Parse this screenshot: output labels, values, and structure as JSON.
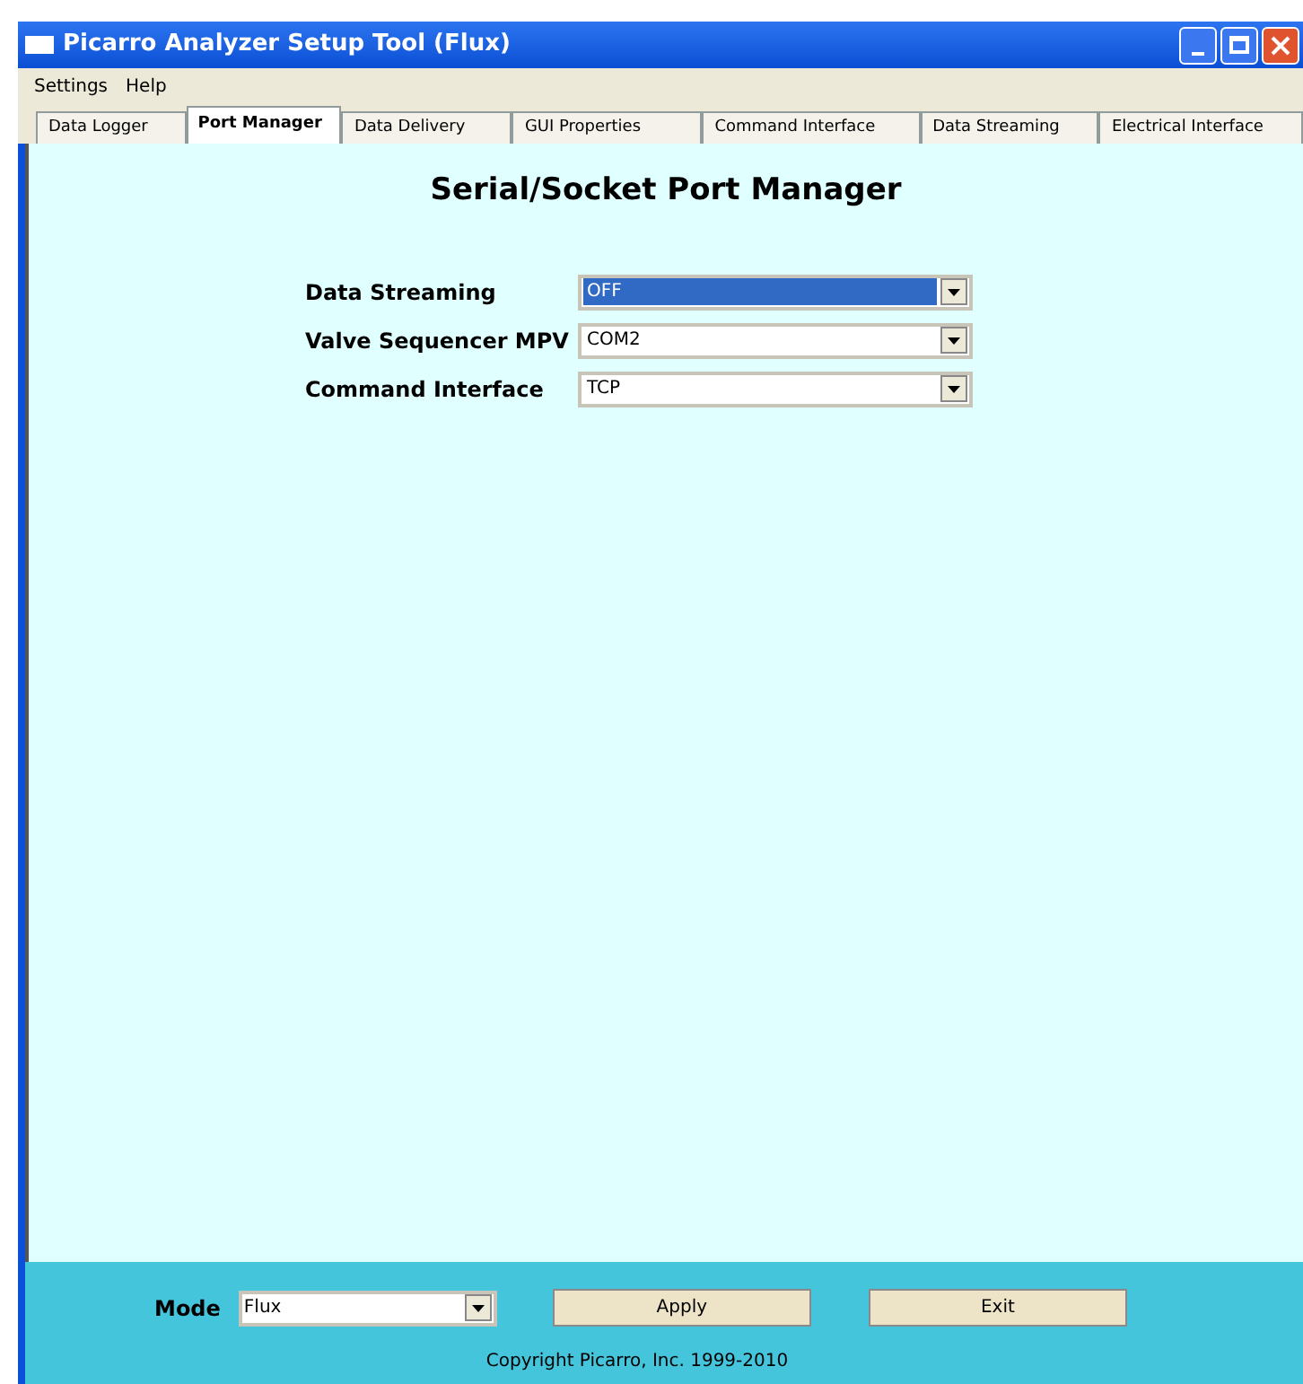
{
  "window": {
    "title": "Picarro Analyzer Setup Tool (Flux)"
  },
  "menu": [
    "Settings",
    "Help"
  ],
  "tabs": [
    {
      "label": "Data Logger",
      "selected": false
    },
    {
      "label": "Port Manager",
      "selected": true
    },
    {
      "label": "Data Delivery",
      "selected": false
    },
    {
      "label": "GUI Properties",
      "selected": false
    },
    {
      "label": "Command Interface",
      "selected": false
    },
    {
      "label": "Data Streaming",
      "selected": false
    },
    {
      "label": "Electrical Interface",
      "selected": false
    }
  ],
  "heading": "Serial/Socket Port Manager",
  "ports": [
    {
      "label": "Data Streaming",
      "value": "OFF",
      "highlighted": true
    },
    {
      "label": "Valve Sequencer MPV",
      "value": "COM2",
      "highlighted": false
    },
    {
      "label": "Command Interface",
      "value": "TCP",
      "highlighted": false
    }
  ],
  "footer": {
    "mode_label": "Mode",
    "mode_value": "Flux",
    "buttons": [
      "Apply",
      "Exit"
    ],
    "copyright": "Copyright Picarro, Inc. 1999-2010"
  }
}
